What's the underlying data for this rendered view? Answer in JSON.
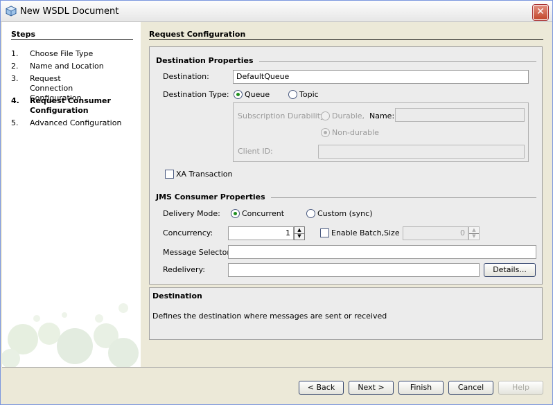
{
  "window": {
    "title": "New WSDL Document"
  },
  "steps": {
    "title": "Steps",
    "items": [
      {
        "num": "1.",
        "label": "Choose File Type"
      },
      {
        "num": "2.",
        "label": "Name and Location"
      },
      {
        "num": "3.",
        "label": "Request Connection Configuration"
      },
      {
        "num": "4.",
        "label": "Request Consumer Configuration",
        "active": true
      },
      {
        "num": "5.",
        "label": "Advanced Configuration"
      }
    ]
  },
  "main": {
    "title": "Request Configuration"
  },
  "destination": {
    "section_title": "Destination Properties",
    "destination_label": "Destination:",
    "destination_value": "DefaultQueue",
    "type_label": "Destination Type:",
    "queue_label": "Queue",
    "topic_label": "Topic",
    "selected_type": "Queue",
    "subscription_durability_label": "Subscription Durability:",
    "durable_label": "Durable,",
    "name_label": "Name:",
    "name_value": "",
    "non_durable_label": "Non-durable",
    "client_id_label": "Client ID:",
    "client_id_value": "",
    "xa_label": "XA Transaction",
    "xa_checked": false
  },
  "consumer": {
    "section_title": "JMS Consumer Properties",
    "delivery_mode_label": "Delivery Mode:",
    "concurrent_label": "Concurrent",
    "custom_label": "Custom (sync)",
    "selected_mode": "Concurrent",
    "concurrency_label": "Concurrency:",
    "concurrency_value": "1",
    "enable_batch_label": "Enable Batch,",
    "enable_batch_checked": false,
    "size_label": "Size",
    "size_value": "0",
    "message_selector_label": "Message Selector:",
    "message_selector_value": "",
    "redelivery_label": "Redelivery:",
    "redelivery_value": "",
    "details_button": "Details..."
  },
  "help": {
    "title": "Destination",
    "text": "Defines the destination where messages are sent or received"
  },
  "buttons": {
    "back": "< Back",
    "next": "Next >",
    "finish": "Finish",
    "cancel": "Cancel",
    "help": "Help"
  },
  "colors": {
    "radio_selected": "#1f8f1f",
    "close_button": "#c3472c"
  },
  "icons": {
    "window": "netbeans-cube-icon",
    "close": "close-icon"
  }
}
